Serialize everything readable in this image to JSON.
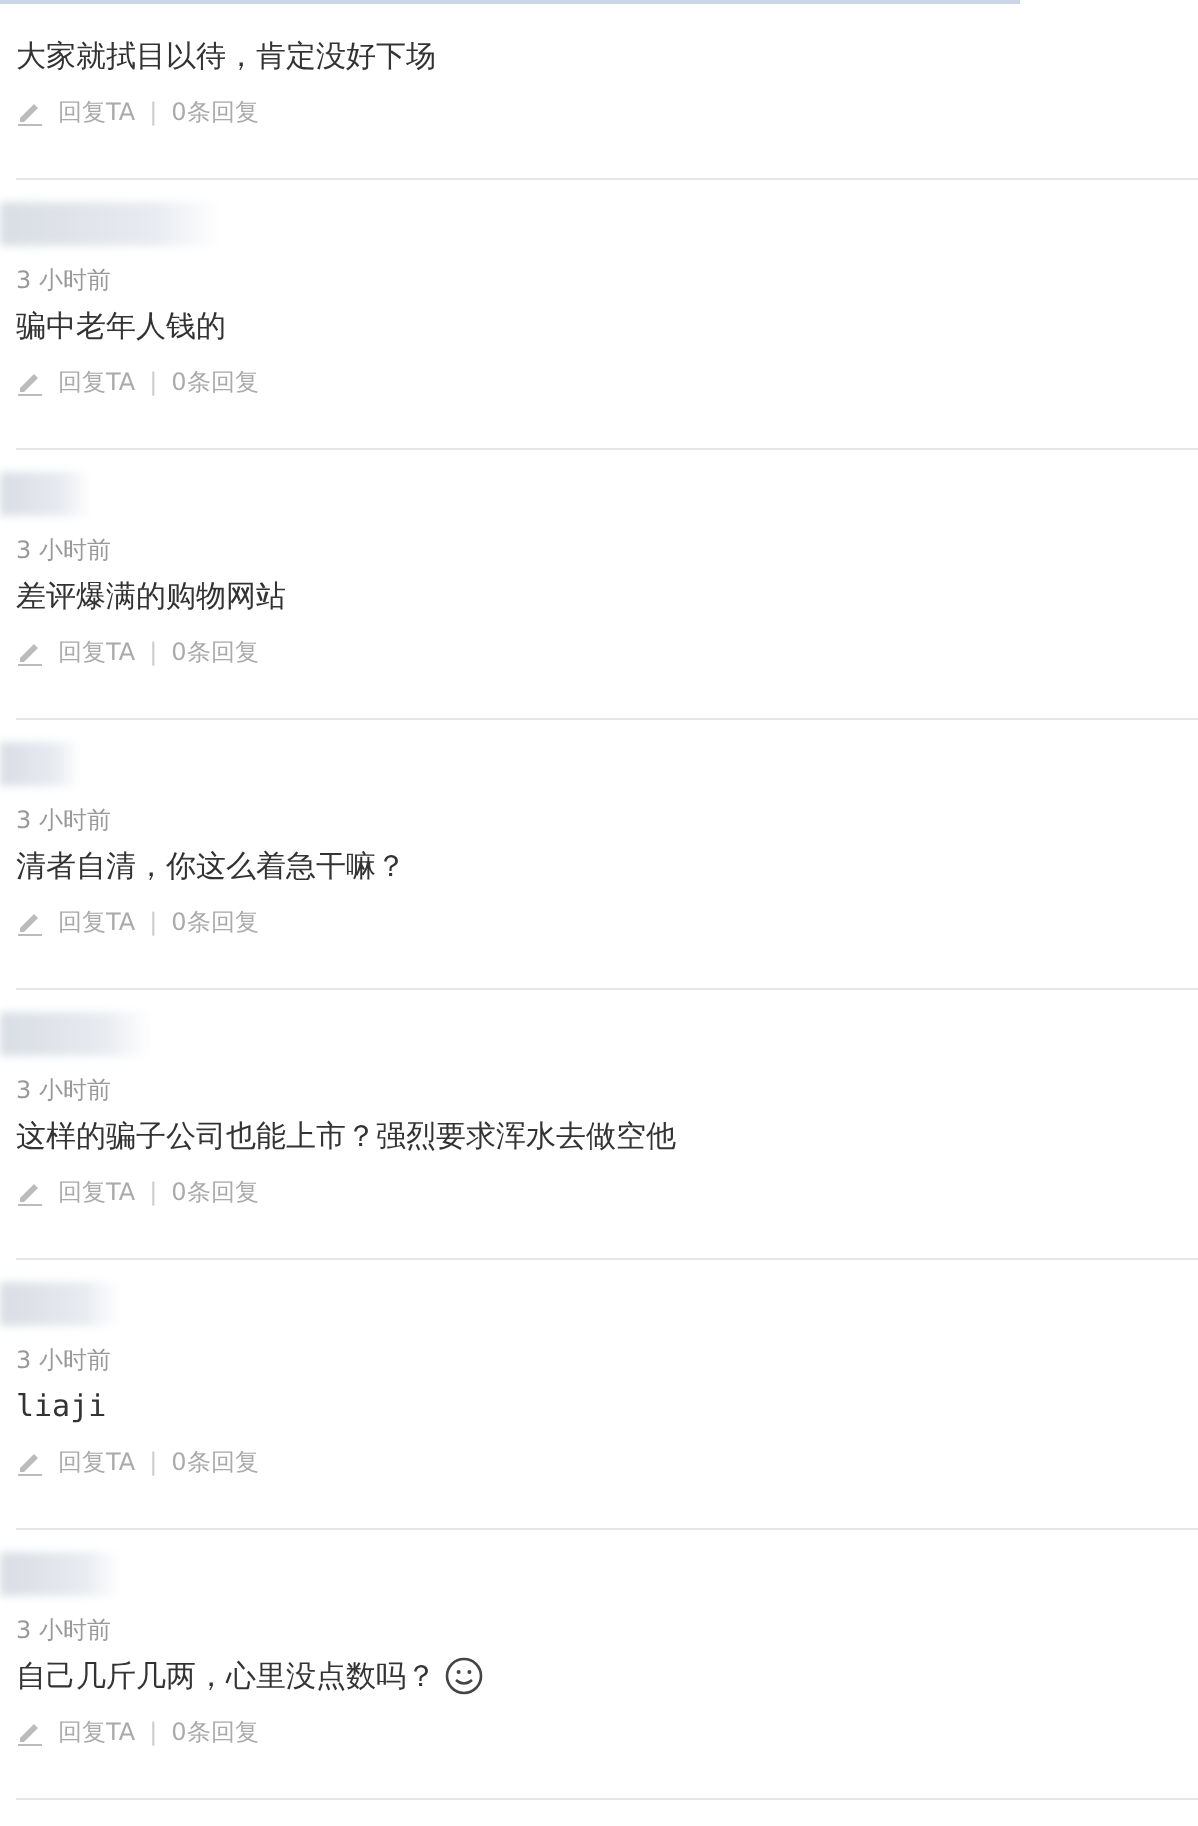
{
  "comments": [
    {
      "content": "大家就拭目以待，肯定没好下场",
      "reply": "回复TA",
      "separator": "|",
      "reply_count": "0条回复"
    },
    {
      "time": "3 小时前",
      "content": "骗中老年人钱的",
      "reply": "回复TA",
      "separator": "|",
      "reply_count": "0条回复"
    },
    {
      "time": "3 小时前",
      "content": "差评爆满的购物网站",
      "reply": "回复TA",
      "separator": "|",
      "reply_count": "0条回复"
    },
    {
      "time": "3 小时前",
      "content": "清者自清，你这么着急干嘛？",
      "reply": "回复TA",
      "separator": "|",
      "reply_count": "0条回复"
    },
    {
      "time": "3 小时前",
      "content": "这样的骗子公司也能上市？强烈要求浑水去做空他",
      "reply": "回复TA",
      "separator": "|",
      "reply_count": "0条回复"
    },
    {
      "time": "3 小时前",
      "content": "liaji",
      "latin": true,
      "reply": "回复TA",
      "separator": "|",
      "reply_count": "0条回复"
    },
    {
      "time": "3 小时前",
      "content": "自己几斤几两，心里没点数吗？",
      "smiley": true,
      "reply": "回复TA",
      "separator": "|",
      "reply_count": "0条回复"
    }
  ]
}
